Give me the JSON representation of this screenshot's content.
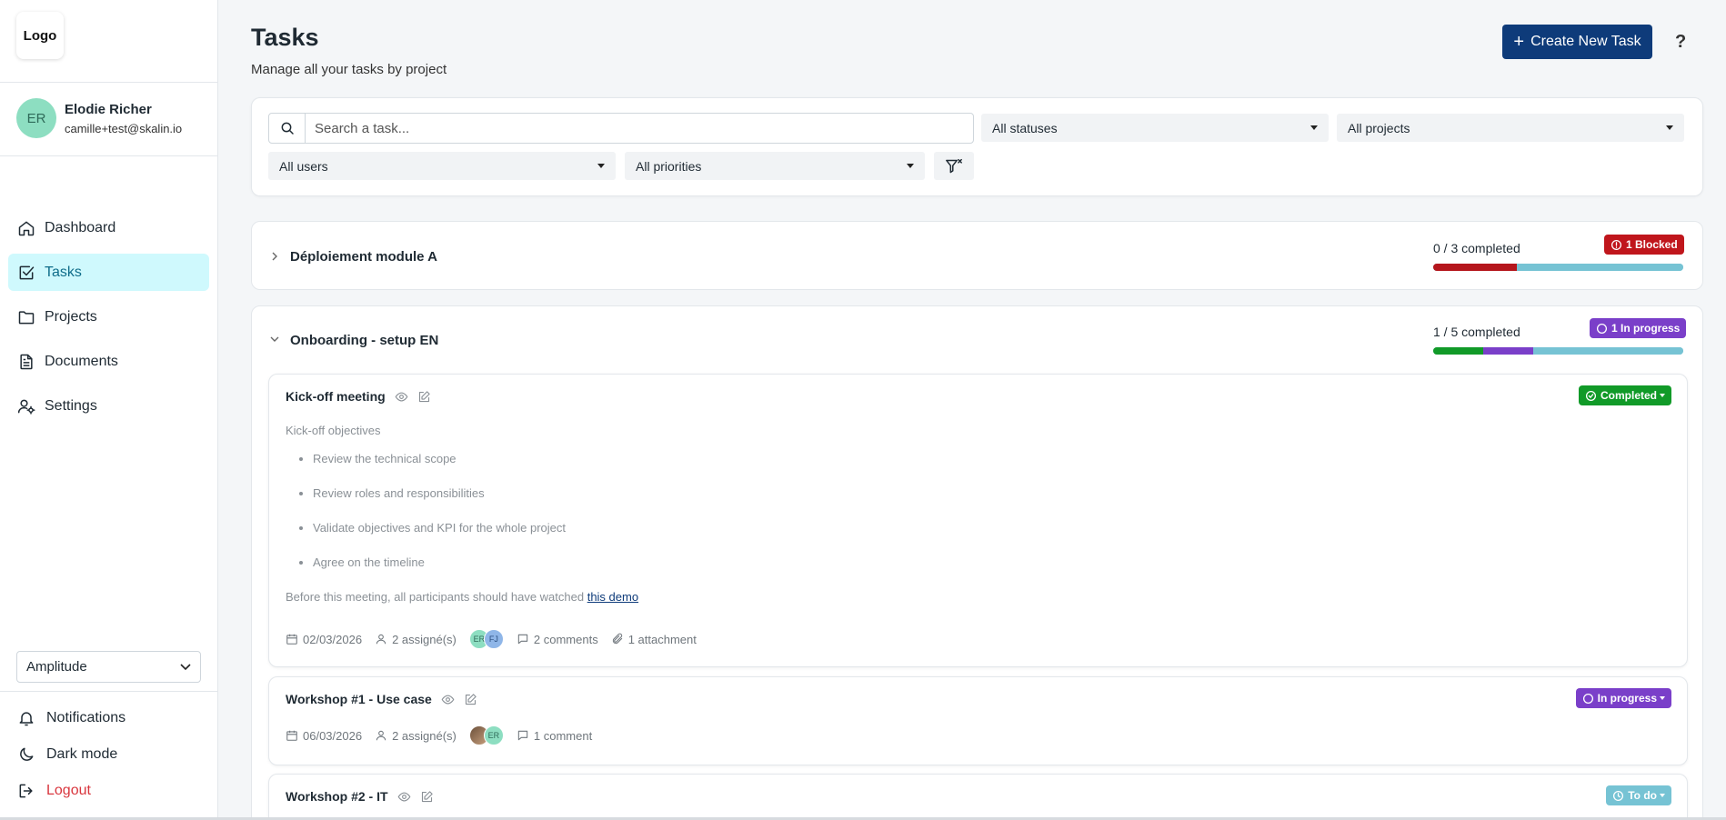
{
  "sidebar": {
    "logo": "Logo",
    "user": {
      "initials": "ER",
      "name": "Elodie Richer",
      "email": "camille+test@skalin.io"
    },
    "nav": [
      {
        "label": "Dashboard",
        "icon": "home-icon"
      },
      {
        "label": "Tasks",
        "icon": "checkbox-icon",
        "active": true
      },
      {
        "label": "Projects",
        "icon": "folder-icon"
      },
      {
        "label": "Documents",
        "icon": "document-icon"
      },
      {
        "label": "Settings",
        "icon": "user-gear-icon"
      }
    ],
    "org_select": "Amplitude",
    "bottom": {
      "notifications": "Notifications",
      "dark_mode": "Dark mode",
      "logout": "Logout"
    }
  },
  "header": {
    "title": "Tasks",
    "subtitle": "Manage all your tasks by project",
    "create_label": "Create New Task",
    "help": "?"
  },
  "filters": {
    "search_placeholder": "Search a task...",
    "statuses": "All statuses",
    "projects": "All projects",
    "users": "All users",
    "priorities": "All priorities"
  },
  "groups": [
    {
      "name": "Déploiement module A",
      "completed": "0 / 3 completed",
      "badge": "1 Blocked",
      "badge_color": "#c0161c",
      "progress": [
        {
          "color": "#b5161c",
          "fraction": 0.333
        },
        {
          "color": "#76c3d4",
          "fraction": 0.667
        }
      ]
    },
    {
      "name": "Onboarding - setup EN",
      "completed": "1 / 5 completed",
      "badge": "1 In progress",
      "badge_color": "#7a3fc9",
      "progress": [
        {
          "color": "#119a28",
          "fraction": 0.2
        },
        {
          "color": "#7a3fc9",
          "fraction": 0.2
        },
        {
          "color": "#76c3d4",
          "fraction": 0.6
        }
      ]
    }
  ],
  "tasks": [
    {
      "title": "Kick-off meeting",
      "status": "Completed",
      "status_color": "#119a28",
      "description_heading": "Kick-off objectives",
      "bullets": [
        "Review the technical scope",
        "Review roles and responsibilities",
        "Validate objectives and KPI for the whole project",
        "Agree on the timeline"
      ],
      "note_prefix": "Before this meeting, all participants should have watched ",
      "note_link": "this demo",
      "date": "02/03/2026",
      "assignees": "2 assigné(s)",
      "avatars": [
        "ER",
        "FJ"
      ],
      "comments": "2 comments",
      "attachments": "1 attachment"
    },
    {
      "title": "Workshop #1 - Use case",
      "status": "In progress",
      "status_color": "#7a3fc9",
      "date": "06/03/2026",
      "assignees": "2 assigné(s)",
      "avatars": [
        "",
        "ER"
      ],
      "comments": "1 comment"
    },
    {
      "title": "Workshop #2 - IT",
      "status": "To do",
      "status_color": "#76c3d4"
    }
  ]
}
